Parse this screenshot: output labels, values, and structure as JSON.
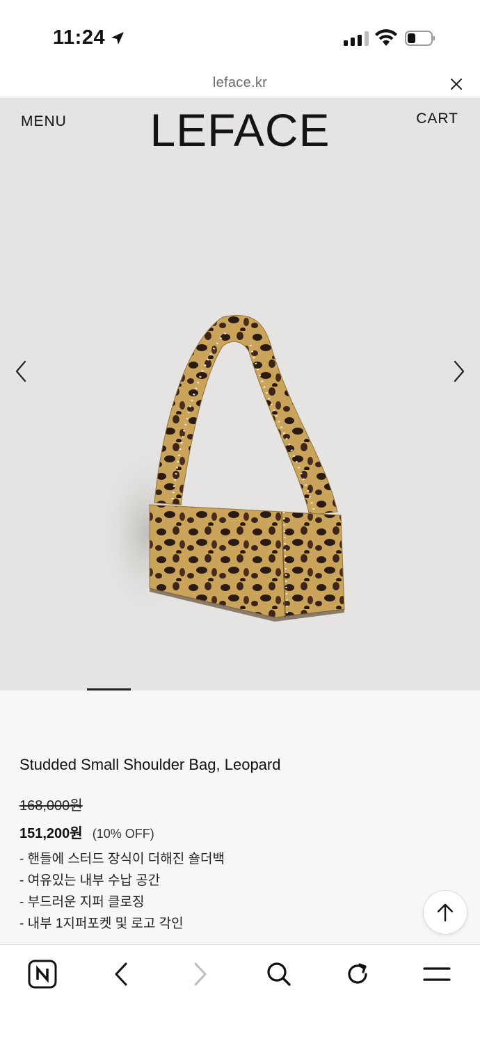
{
  "status_bar": {
    "time": "11:24",
    "icons": [
      "location-arrow-icon",
      "cellular-signal-icon",
      "wifi-icon",
      "battery-icon"
    ]
  },
  "browser": {
    "url": "leface.kr",
    "close_icon": "close-icon"
  },
  "header": {
    "menu_label": "MENU",
    "logo": "LEFACE",
    "cart_label": "CART"
  },
  "gallery": {
    "prev_icon": "chevron-left-icon",
    "next_icon": "chevron-right-icon",
    "image": "leopard-print-shoulder-bag",
    "slide_indicator_fraction": 0.09
  },
  "product": {
    "name": "Studded Small Shoulder Bag, Leopard",
    "original_price": "168,000원",
    "sale_price": "151,200원",
    "discount": "(10% OFF)",
    "features": [
      "- 핸들에 스터드 장식이 더해진 숄더백",
      "- 여유있는 내부 수납 공간",
      "- 부드러운 지퍼 클로징",
      "- 내부 1지퍼포켓 및 로고 각인"
    ]
  },
  "scroll_top_icon": "arrow-up-icon",
  "toolbar": {
    "items": [
      "naver-home-icon",
      "back-icon",
      "forward-icon",
      "search-icon",
      "refresh-icon",
      "menu-icon"
    ]
  },
  "colors": {
    "hero_background": "#e6e4e2",
    "info_background": "#f7f7f7",
    "leopard_base": "#c9a45a",
    "leopard_spot": "#2a1a12"
  }
}
